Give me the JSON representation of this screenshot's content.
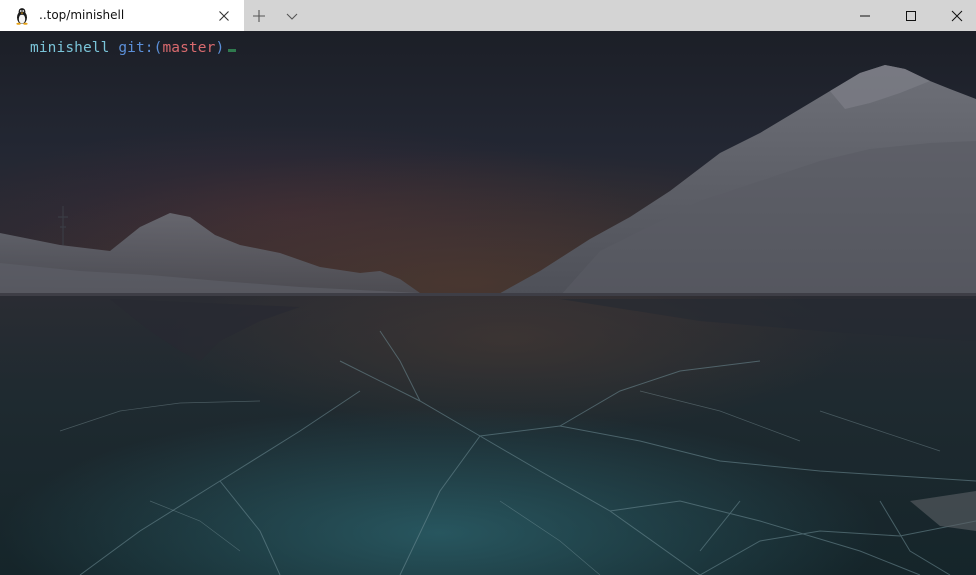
{
  "tab": {
    "title": "..top/minishell",
    "icon": "linux-tux-icon"
  },
  "titlebar": {
    "new_tab_icon": "plus-icon",
    "dropdown_icon": "chevron-down-icon",
    "minimize_icon": "minimize-icon",
    "maximize_icon": "maximize-icon",
    "close_icon": "close-icon"
  },
  "terminal": {
    "prompt_dir": "minishell",
    "prompt_git": "git:(",
    "prompt_branch": "master",
    "prompt_git_close": ")",
    "colors": {
      "dir": "#7ac4d8",
      "git": "#5b8fd8",
      "branch": "#d96a6e",
      "cursor": "#2f7a4e"
    }
  }
}
